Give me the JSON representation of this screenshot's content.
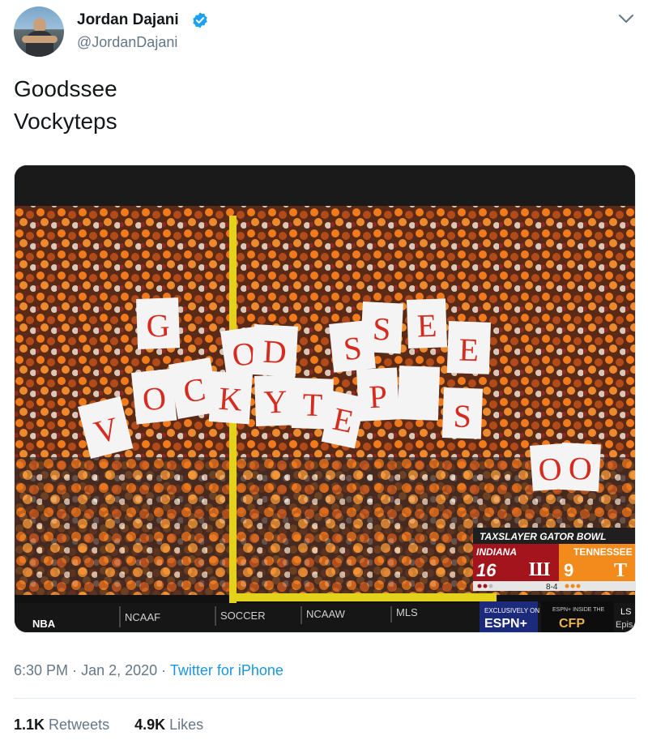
{
  "author": {
    "display_name": "Jordan Dajani",
    "handle": "@JordanDajani",
    "verified": true
  },
  "tweet": {
    "lines": [
      "Goodssee",
      "Vockyteps"
    ]
  },
  "media": {
    "scorebug": {
      "title": "TAXSLAYER GATOR BOWL",
      "team1": "INDIANA",
      "score1": "16",
      "team2": "TENNESSEE",
      "score2": "9",
      "record": "8-4"
    },
    "ribbon": [
      "NBA",
      "NCAAF",
      "SOCCER",
      "NCAAW",
      "MLS"
    ],
    "promo": {
      "label": "EXCLUSIVELY ON",
      "brand": "ESPN+",
      "show_small": "ESPN+ INSIDE THE",
      "show": "CFP",
      "extra": "LS",
      "episode": "Epis"
    },
    "signs": [
      "G",
      "O",
      "D",
      "S",
      "S",
      "E",
      "E",
      "V",
      "O",
      "C",
      "K",
      "Y",
      "T",
      "E",
      "P",
      "S",
      "O",
      "O"
    ]
  },
  "meta": {
    "time": "6:30 PM",
    "sep": "·",
    "date": "Jan 2, 2020",
    "source": "Twitter for iPhone"
  },
  "stats": {
    "retweets_count": "1.1K",
    "retweets_label": "Retweets",
    "likes_count": "4.9K",
    "likes_label": "Likes"
  },
  "colors": {
    "link": "#1b95e0",
    "verified": "#1da1f2",
    "muted": "#657786",
    "tennessee_orange": "#ff8200",
    "indiana_red": "#990000"
  }
}
